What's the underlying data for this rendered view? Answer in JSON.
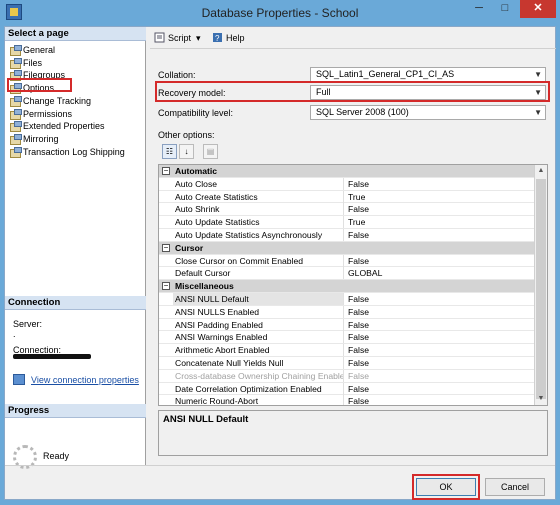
{
  "window": {
    "title": "Database Properties - School",
    "minimize": "─",
    "maximize": "□",
    "close": "✕"
  },
  "left": {
    "select_header": "Select a page",
    "pages": [
      "General",
      "Files",
      "Filegroups",
      "Options",
      "Change Tracking",
      "Permissions",
      "Extended Properties",
      "Mirroring",
      "Transaction Log Shipping"
    ],
    "selected_page": "Options",
    "connection_header": "Connection",
    "server_label": "Server:",
    "server_value": ".",
    "connection_label": "Connection:",
    "view_connection": "View connection properties",
    "progress_header": "Progress",
    "progress_status": "Ready"
  },
  "toolbar": {
    "script": "Script",
    "help": "Help",
    "dropdown": "▾"
  },
  "form": {
    "collation_label": "Collation:",
    "collation_value": "SQL_Latin1_General_CP1_CI_AS",
    "recovery_label": "Recovery model:",
    "recovery_value": "Full",
    "compat_label": "Compatibility level:",
    "compat_value": "SQL Server 2008 (100)",
    "other_options_label": "Other options:"
  },
  "grid": {
    "rows": [
      {
        "type": "cat",
        "name": "Automatic"
      },
      {
        "name": "Auto Close",
        "value": "False"
      },
      {
        "name": "Auto Create Statistics",
        "value": "True"
      },
      {
        "name": "Auto Shrink",
        "value": "False"
      },
      {
        "name": "Auto Update Statistics",
        "value": "True"
      },
      {
        "name": "Auto Update Statistics Asynchronously",
        "value": "False"
      },
      {
        "type": "cat",
        "name": "Cursor"
      },
      {
        "name": "Close Cursor on Commit Enabled",
        "value": "False"
      },
      {
        "name": "Default Cursor",
        "value": "GLOBAL"
      },
      {
        "type": "cat",
        "name": "Miscellaneous"
      },
      {
        "name": "ANSI NULL Default",
        "value": "False",
        "selected": true
      },
      {
        "name": "ANSI NULLS Enabled",
        "value": "False"
      },
      {
        "name": "ANSI Padding Enabled",
        "value": "False"
      },
      {
        "name": "ANSI Warnings Enabled",
        "value": "False"
      },
      {
        "name": "Arithmetic Abort Enabled",
        "value": "False"
      },
      {
        "name": "Concatenate Null Yields Null",
        "value": "False"
      },
      {
        "name": "Cross-database Ownership Chaining Enabled",
        "value": "False",
        "disabled": true
      },
      {
        "name": "Date Correlation Optimization Enabled",
        "value": "False"
      },
      {
        "name": "Numeric Round-Abort",
        "value": "False"
      }
    ]
  },
  "description": "ANSI NULL Default",
  "buttons": {
    "ok": "OK",
    "cancel": "Cancel"
  },
  "colors": {
    "highlight": "#d42a2a",
    "window_frame": "#6aa9d8",
    "close_button": "#c7372f"
  }
}
